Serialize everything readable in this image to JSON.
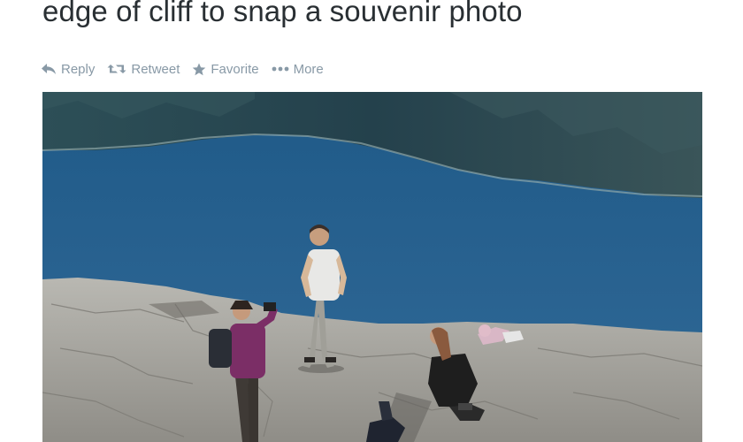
{
  "tweet": {
    "text": "edge of cliff to snap a souvenir photo"
  },
  "actions": [
    {
      "label": "Reply",
      "icon": "reply-icon"
    },
    {
      "label": "Retweet",
      "icon": "retweet-icon"
    },
    {
      "label": "Favorite",
      "icon": "star-icon"
    },
    {
      "label": "More",
      "icon": "more-dots-icon"
    }
  ],
  "colors": {
    "text": "#292f33",
    "action_gray": "#8899a6",
    "fjord_water": "#2a6190",
    "mountain": "#2c4a52",
    "cliff_rock": "#a9a8a2"
  }
}
